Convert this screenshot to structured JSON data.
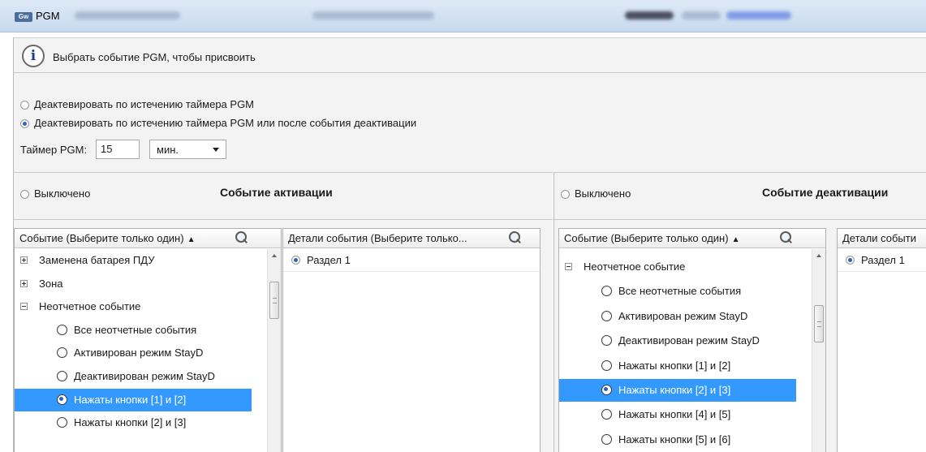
{
  "window": {
    "title": "PGM",
    "app_icon": "Gw"
  },
  "info": {
    "text": "Выбрать событие PGM, чтобы присвоить",
    "icon": "info-icon"
  },
  "options": {
    "deactivate_timer": "Деактевировать по истечению таймера PGM",
    "deactivate_timer_or_event": "Деактевировать по истечению таймера PGM или после события деактивации",
    "selected": "deactivate_timer_or_event",
    "timer_label": "Таймер PGM:",
    "timer_value": "15",
    "timer_unit": "мин."
  },
  "activation": {
    "off_label": "Выключено",
    "title": "Событие активации",
    "event_header": "Событие (Выберите только один)",
    "details_header": "Детали события (Выберите только...",
    "details": [
      "Раздел 1"
    ],
    "events": [
      {
        "type": "group",
        "expander": "plus",
        "label": "Заменена батарея ПДУ"
      },
      {
        "type": "group",
        "expander": "plus",
        "label": "Зона"
      },
      {
        "type": "group",
        "expander": "minus",
        "label": "Неотчетное событие"
      },
      {
        "type": "item",
        "label": "Все неотчетные события",
        "selected": false
      },
      {
        "type": "item",
        "label": "Активирован режим StayD",
        "selected": false
      },
      {
        "type": "item",
        "label": "Деактивирован режим StayD",
        "selected": false
      },
      {
        "type": "item",
        "label": "Нажаты кнопки [1] и [2]",
        "selected": true
      },
      {
        "type": "item",
        "label": "Нажаты кнопки [2] и [3]",
        "selected": false
      }
    ]
  },
  "deactivation": {
    "off_label": "Выключено",
    "title": "Событие деактивации",
    "event_header": "Событие (Выберите только один)",
    "details_header": "Детали событи",
    "details": [
      "Раздел 1"
    ],
    "events": [
      {
        "type": "group",
        "expander": "minus",
        "label": "Неотчетное событие"
      },
      {
        "type": "item",
        "label": "Все неотчетные события",
        "selected": false
      },
      {
        "type": "item",
        "label": "Активирован режим StayD",
        "selected": false
      },
      {
        "type": "item",
        "label": "Деактивирован режим StayD",
        "selected": false
      },
      {
        "type": "item",
        "label": "Нажаты кнопки [1] и [2]",
        "selected": false
      },
      {
        "type": "item",
        "label": "Нажаты кнопки [2] и [3]",
        "selected": true
      },
      {
        "type": "item",
        "label": "Нажаты кнопки [4] и [5]",
        "selected": false
      },
      {
        "type": "item",
        "label": "Нажаты кнопки [5] и [6]",
        "selected": false
      }
    ]
  },
  "colors": {
    "selection": "#3399ff",
    "panel_bg": "#f3f3f3",
    "titlebar": "#c8daef"
  }
}
